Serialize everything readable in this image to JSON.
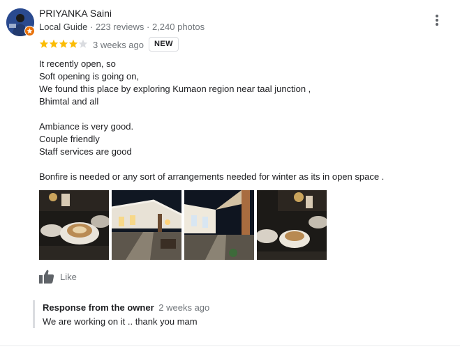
{
  "reviewer": {
    "name": "PRIYANKA Saini",
    "level": "Local Guide",
    "reviews": "223 reviews",
    "photos": "2,240 photos",
    "separator": "·"
  },
  "rating": {
    "value": 4,
    "max": 5,
    "filled_color": "#fbbc04",
    "empty_color": "#dadce0"
  },
  "time_ago": "3 weeks ago",
  "badge": "NEW",
  "review_lines": [
    "It recently open, so",
    "Soft opening is going on,",
    "We found this place by exploring Kumaon region near taal junction ,",
    "Bhimtal and all",
    "",
    "Ambiance is very good.",
    "Couple friendly",
    "Staff services are good",
    "",
    "Bonfire is needed or any sort of arrangements needed for winter as its in open space ."
  ],
  "photos": [
    "coffee-table-photo",
    "courtyard-night-photo",
    "courtyard-walkway-photo",
    "coffee-cups-photo"
  ],
  "like_label": "Like",
  "owner_response": {
    "title": "Response from the owner",
    "time_ago": "2 weeks ago",
    "text": "We are working on it .. thank you mam"
  },
  "colors": {
    "accent_badge": "#e8710a",
    "meta_text": "#70757a"
  }
}
